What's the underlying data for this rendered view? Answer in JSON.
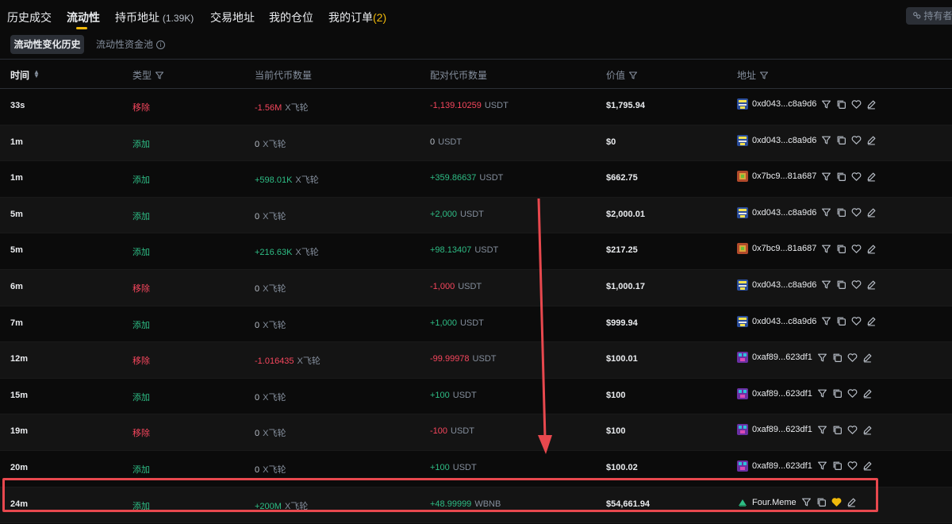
{
  "tabs": [
    {
      "label": "历史成交"
    },
    {
      "label": "流动性"
    },
    {
      "label": "持币地址",
      "count": "(1.39K)"
    },
    {
      "label": "交易地址"
    },
    {
      "label": "我的仓位"
    },
    {
      "label": "我的订单",
      "badge": "(2)"
    }
  ],
  "holders_button": "持有者",
  "subtabs": {
    "active": "流动性变化历史",
    "other": "流动性资金池"
  },
  "columns": {
    "time": "时间",
    "type": "类型",
    "current_amount": "当前代币数量",
    "pair_amount": "配对代币数量",
    "value": "价值",
    "address": "地址"
  },
  "colors": {
    "accent": "#f0b90b",
    "positive": "#2ebd85",
    "negative": "#f6465d",
    "highlight": "#e8484e"
  },
  "rows": [
    {
      "time": "33s",
      "type": "移除",
      "type_kind": "neg",
      "cur": "-1.56M",
      "cur_kind": "neg",
      "cur_unit": "X飞轮",
      "pair": "-1,139.10259",
      "pair_kind": "neg",
      "pair_unit": "USDT",
      "value": "$1,795.94",
      "address": "0xd043...c8a9d6",
      "avatar": "a1"
    },
    {
      "time": "1m",
      "type": "添加",
      "type_kind": "pos",
      "cur": "0",
      "cur_kind": "neu",
      "cur_unit": "X飞轮",
      "pair": "0",
      "pair_kind": "neu",
      "pair_unit": "USDT",
      "value": "$0",
      "address": "0xd043...c8a9d6",
      "avatar": "a1"
    },
    {
      "time": "1m",
      "type": "添加",
      "type_kind": "pos",
      "cur": "+598.01K",
      "cur_kind": "pos",
      "cur_unit": "X飞轮",
      "pair": "+359.86637",
      "pair_kind": "pos",
      "pair_unit": "USDT",
      "value": "$662.75",
      "address": "0x7bc9...81a687",
      "avatar": "a2"
    },
    {
      "time": "5m",
      "type": "添加",
      "type_kind": "pos",
      "cur": "0",
      "cur_kind": "neu",
      "cur_unit": "X飞轮",
      "pair": "+2,000",
      "pair_kind": "pos",
      "pair_unit": "USDT",
      "value": "$2,000.01",
      "address": "0xd043...c8a9d6",
      "avatar": "a1"
    },
    {
      "time": "5m",
      "type": "添加",
      "type_kind": "pos",
      "cur": "+216.63K",
      "cur_kind": "pos",
      "cur_unit": "X飞轮",
      "pair": "+98.13407",
      "pair_kind": "pos",
      "pair_unit": "USDT",
      "value": "$217.25",
      "address": "0x7bc9...81a687",
      "avatar": "a2"
    },
    {
      "time": "6m",
      "type": "移除",
      "type_kind": "neg",
      "cur": "0",
      "cur_kind": "neu",
      "cur_unit": "X飞轮",
      "pair": "-1,000",
      "pair_kind": "neg",
      "pair_unit": "USDT",
      "value": "$1,000.17",
      "address": "0xd043...c8a9d6",
      "avatar": "a1"
    },
    {
      "time": "7m",
      "type": "添加",
      "type_kind": "pos",
      "cur": "0",
      "cur_kind": "neu",
      "cur_unit": "X飞轮",
      "pair": "+1,000",
      "pair_kind": "pos",
      "pair_unit": "USDT",
      "value": "$999.94",
      "address": "0xd043...c8a9d6",
      "avatar": "a1"
    },
    {
      "time": "12m",
      "type": "移除",
      "type_kind": "neg",
      "cur": "-1.016435",
      "cur_kind": "neg",
      "cur_unit": "X飞轮",
      "pair": "-99.99978",
      "pair_kind": "neg",
      "pair_unit": "USDT",
      "value": "$100.01",
      "address": "0xaf89...623df1",
      "avatar": "a3"
    },
    {
      "time": "15m",
      "type": "添加",
      "type_kind": "pos",
      "cur": "0",
      "cur_kind": "neu",
      "cur_unit": "X飞轮",
      "pair": "+100",
      "pair_kind": "pos",
      "pair_unit": "USDT",
      "value": "$100",
      "address": "0xaf89...623df1",
      "avatar": "a3"
    },
    {
      "time": "19m",
      "type": "移除",
      "type_kind": "neg",
      "cur": "0",
      "cur_kind": "neu",
      "cur_unit": "X飞轮",
      "pair": "-100",
      "pair_kind": "neg",
      "pair_unit": "USDT",
      "value": "$100",
      "address": "0xaf89...623df1",
      "avatar": "a3"
    },
    {
      "time": "20m",
      "type": "添加",
      "type_kind": "pos",
      "cur": "0",
      "cur_kind": "neu",
      "cur_unit": "X飞轮",
      "pair": "+100",
      "pair_kind": "pos",
      "pair_unit": "USDT",
      "value": "$100.02",
      "address": "0xaf89...623df1",
      "avatar": "a3"
    },
    {
      "time": "24m",
      "type": "添加",
      "type_kind": "pos",
      "cur": "+200M",
      "cur_kind": "pos",
      "cur_unit": "X飞轮",
      "pair": "+48.99999",
      "pair_kind": "pos",
      "pair_unit": "WBNB",
      "value": "$54,661.94",
      "address": "Four.Meme",
      "avatar": "four",
      "favorited": true
    }
  ]
}
